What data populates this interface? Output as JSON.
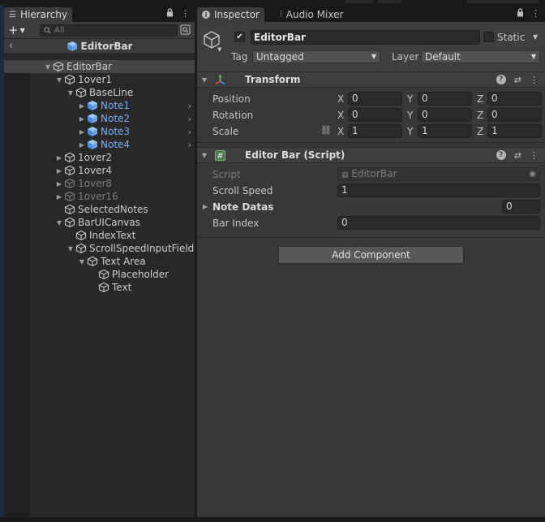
{
  "hierarchy": {
    "tab_label": "Hierarchy",
    "search_placeholder": "All",
    "add_label": "+",
    "scene_title": "EditorBar",
    "tree": [
      {
        "label": "EditorBar",
        "depth": 0,
        "arrow": "open",
        "style": "normal",
        "selected": true
      },
      {
        "label": "1over1",
        "depth": 1,
        "arrow": "open",
        "style": "normal"
      },
      {
        "label": "BaseLine",
        "depth": 2,
        "arrow": "open",
        "style": "normal"
      },
      {
        "label": "Note1",
        "depth": 3,
        "arrow": "closed",
        "style": "blue",
        "chevron": true
      },
      {
        "label": "Note2",
        "depth": 3,
        "arrow": "closed",
        "style": "blue",
        "chevron": true
      },
      {
        "label": "Note3",
        "depth": 3,
        "arrow": "closed",
        "style": "blue",
        "chevron": true
      },
      {
        "label": "Note4",
        "depth": 3,
        "arrow": "closed",
        "style": "blue",
        "chevron": true
      },
      {
        "label": "1over2",
        "depth": 1,
        "arrow": "closed",
        "style": "normal"
      },
      {
        "label": "1over4",
        "depth": 1,
        "arrow": "closed",
        "style": "normal"
      },
      {
        "label": "1over8",
        "depth": 1,
        "arrow": "closed",
        "style": "dim"
      },
      {
        "label": "1over16",
        "depth": 1,
        "arrow": "closed",
        "style": "dim"
      },
      {
        "label": "SelectedNotes",
        "depth": 1,
        "arrow": "none",
        "style": "normal"
      },
      {
        "label": "BarUICanvas",
        "depth": 1,
        "arrow": "open",
        "style": "normal"
      },
      {
        "label": "IndexText",
        "depth": 2,
        "arrow": "none",
        "style": "normal"
      },
      {
        "label": "ScrollSpeedInputField",
        "depth": 2,
        "arrow": "open",
        "style": "normal"
      },
      {
        "label": "Text Area",
        "depth": 3,
        "arrow": "open",
        "style": "normal"
      },
      {
        "label": "Placeholder",
        "depth": 4,
        "arrow": "none",
        "style": "normal"
      },
      {
        "label": "Text",
        "depth": 4,
        "arrow": "none",
        "style": "normal"
      }
    ]
  },
  "inspector": {
    "tab_label": "Inspector",
    "mixer_tab_label": "Audio Mixer",
    "object_name": "EditorBar",
    "static_label": "Static",
    "tag_label": "Tag",
    "tag_value": "Untagged",
    "layer_label": "Layer",
    "layer_value": "Default",
    "transform": {
      "title": "Transform",
      "rows": [
        {
          "label": "Position",
          "x": "0",
          "y": "0",
          "z": "0"
        },
        {
          "label": "Rotation",
          "x": "0",
          "y": "0",
          "z": "0"
        },
        {
          "label": "Scale",
          "x": "1",
          "y": "1",
          "z": "1"
        }
      ],
      "axis_x": "X",
      "axis_y": "Y",
      "axis_z": "Z"
    },
    "script_component": {
      "title": "Editor Bar (Script)",
      "script_label": "Script",
      "script_value": "EditorBar",
      "scroll_speed_label": "Scroll Speed",
      "scroll_speed_value": "1",
      "note_datas_label": "Note Datas",
      "note_datas_value": "0",
      "bar_index_label": "Bar Index",
      "bar_index_value": "0"
    },
    "add_component_label": "Add Component"
  },
  "colors": {
    "blue_prefab": "#7aaef0",
    "selection": "#454545"
  }
}
